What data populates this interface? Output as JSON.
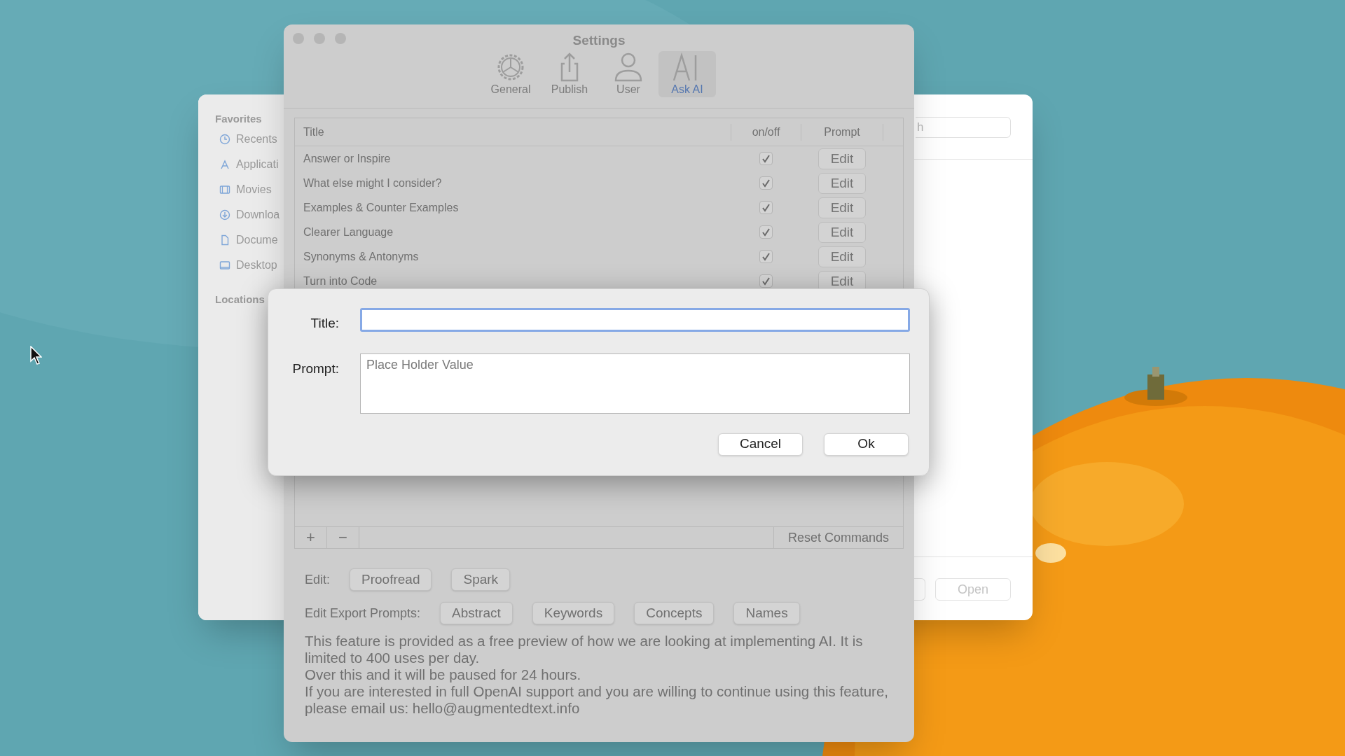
{
  "finder": {
    "sidebar": [
      {
        "title": "Favorites",
        "items": [
          {
            "label": "Recents"
          },
          {
            "label": "Applicati"
          },
          {
            "label": "Movies"
          },
          {
            "label": "Downloa"
          },
          {
            "label": "Docume"
          },
          {
            "label": "Desktop"
          }
        ]
      },
      {
        "title": "Locations"
      }
    ],
    "search": {
      "value": "h"
    },
    "buttons": [
      "Open"
    ]
  },
  "settings": {
    "window": {
      "title": "Settings"
    },
    "toolbar": [
      {
        "label": "General",
        "selected": false
      },
      {
        "label": "Publish",
        "selected": false
      },
      {
        "label": "User",
        "selected": false
      },
      {
        "label": "Ask AI",
        "selected": true
      }
    ],
    "table": {
      "columns": [
        "Title",
        "on/off",
        "Prompt"
      ],
      "rows": [
        {
          "title": "Answer or Inspire",
          "checked": true,
          "action": "Edit"
        },
        {
          "title": "What else might I consider?",
          "checked": true,
          "action": "Edit"
        },
        {
          "title": "Examples & Counter Examples",
          "checked": true,
          "action": "Edit"
        },
        {
          "title": "Clearer Language",
          "checked": true,
          "action": "Edit"
        },
        {
          "title": "Synonyms & Antonyms",
          "checked": true,
          "action": "Edit"
        },
        {
          "title": "Turn into Code",
          "checked": true,
          "action": "Edit"
        }
      ]
    },
    "bottom_bar": {
      "add": "+",
      "remove": "−",
      "reset": "Reset Commands"
    },
    "edit_row": {
      "label": "Edit:",
      "buttons": [
        "Proofread",
        "Spark"
      ]
    },
    "export_row": {
      "label": "Edit Export Prompts:",
      "buttons": [
        "Abstract",
        "Keywords",
        "Concepts",
        "Names"
      ]
    },
    "notice": [
      "This feature is provided as a free preview of how we are looking at implementing AI. It is limited to 400 uses per day.",
      "Over this and it will be paused for 24 hours.",
      "If you are interested in full OpenAI support and you are willing to continue using this feature, please email us: hello@augmentedtext.info"
    ]
  },
  "dialog": {
    "fields": [
      {
        "label": "Title:",
        "kind": "line",
        "focused": true
      },
      {
        "label": "Prompt:",
        "kind": "area",
        "placeholder": "Place Holder Value",
        "focused": false
      }
    ],
    "buttons": [
      "Cancel",
      "Ok"
    ]
  }
}
